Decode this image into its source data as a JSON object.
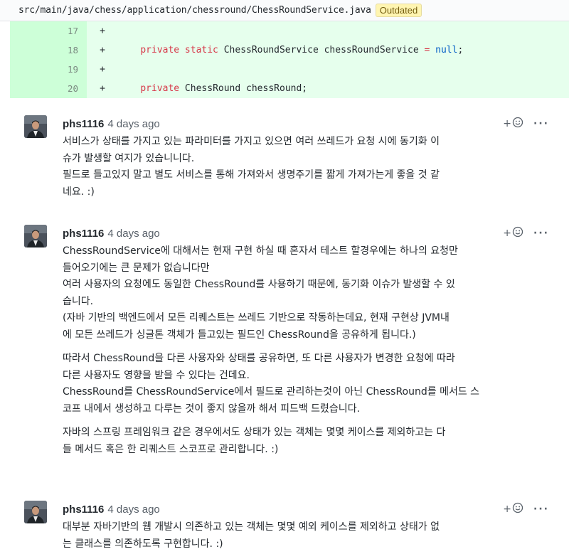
{
  "file": {
    "path": "src/main/java/chess/application/chessround/ChessRoundService.java",
    "badge": "Outdated"
  },
  "diff": [
    {
      "num": "17",
      "sign": "+",
      "tokens": []
    },
    {
      "num": "18",
      "sign": "+",
      "tokens": [
        {
          "t": "    ",
          "c": ""
        },
        {
          "t": "private static",
          "c": "kw"
        },
        {
          "t": " ChessRoundService chessRoundService ",
          "c": ""
        },
        {
          "t": "=",
          "c": "kw"
        },
        {
          "t": " ",
          "c": ""
        },
        {
          "t": "null",
          "c": "const"
        },
        {
          "t": ";",
          "c": ""
        }
      ]
    },
    {
      "num": "19",
      "sign": "+",
      "tokens": []
    },
    {
      "num": "20",
      "sign": "+",
      "tokens": [
        {
          "t": "    ",
          "c": ""
        },
        {
          "t": "private",
          "c": "kw"
        },
        {
          "t": " ChessRound chessRound;",
          "c": ""
        }
      ]
    }
  ],
  "comments": [
    {
      "author": "phs1116",
      "time": "4 days ago",
      "paragraphs": [
        "서비스가 상태를 가지고 있는 파라미터를 가지고 있으면 여러 쓰레드가 요청 시에 동기화 이\n슈가 발생할 여지가 있습니니다.\n필드로 들고있지 말고 별도 서비스를 통해 가져와서 생명주기를 짧게 가져가는게 좋을 것 같\n네요. :)"
      ]
    },
    {
      "author": "phs1116",
      "time": "4 days ago",
      "paragraphs": [
        "ChessRoundService에 대해서는 현재 구현 하실 때 혼자서 테스트 할경우에는 하나의 요청만\n들어오기에는 큰 문제가 없습니다만\n여러 사용자의 요청에도 동일한 ChessRound를 사용하기 때문에, 동기화 이슈가 발생할 수 있\n습니다.\n(자바 기반의 백엔드에서 모든 리퀘스트는 쓰레드 기반으로 작동하는데요, 현재 구현상 JVM내\n에 모든 쓰레드가 싱글톤 객체가 들고있는 필드인 ChessRound을 공유하게 됩니다.)",
        "따라서 ChessRound을 다른 사용자와 상태를 공유하면, 또 다른 사용자가 변경한 요청에 따라\n다른 사용자도 영향을 받을 수 있다는 건데요.\nChessRound를 ChessRoundService에서 필드로 관리하는것이 아닌 ChessRound를 메서드 스\n코프 내에서 생성하고 다루는 것이 좋지 않을까 해서 피드백 드렸습니다.",
        "자바의 스프링 프레임워크 같은 경우에서도 상태가 있는 객체는 몇몇 케이스를 제외하고는 다\n들 메서드 혹은 한 리퀘스트 스코프로 관리합니다. :)"
      ]
    },
    {
      "author": "phs1116",
      "time": "4 days ago",
      "paragraphs": [
        "대부분 자바기반의 웹 개발시 의존하고 있는 객체는 몇몇 예외 케이스를 제외하고 상태가 없\n는 클래스를 의존하도록 구현합니다. :)"
      ]
    }
  ],
  "actions": {
    "react_label": "+",
    "react_icon": "smiley-icon",
    "more_label": "···"
  },
  "colors": {
    "added_bg": "#e6ffed",
    "added_num_bg": "#cdffd8",
    "keyword": "#d73a49",
    "constant": "#005cc5",
    "badge_bg": "#fff5b1"
  }
}
